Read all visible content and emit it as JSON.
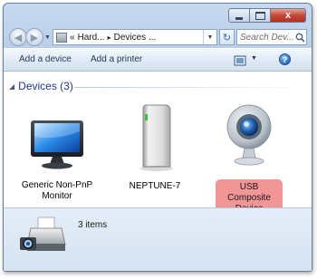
{
  "titlebar": {
    "minimize_glyph": "",
    "maximize_glyph": "",
    "close_glyph": "x"
  },
  "nav": {
    "address_crumbs": [
      "«",
      "Hard...",
      "Devices ..."
    ],
    "crumb_separator": "▸",
    "search_placeholder": "Search Dev...",
    "refresh_icon": "refresh-icon"
  },
  "toolbar": {
    "add_device": "Add a device",
    "add_printer": "Add a printer",
    "help_label": "?"
  },
  "group": {
    "title": "Devices (3)",
    "collapse_glyph": "◢"
  },
  "devices": [
    {
      "label": "Generic Non-PnP Monitor",
      "icon": "monitor-icon",
      "selected": false
    },
    {
      "label": "NEPTUNE-7",
      "icon": "external-drive-icon",
      "selected": false
    },
    {
      "label": "USB Composite Device",
      "icon": "webcam-icon",
      "selected": true
    }
  ],
  "details": {
    "count_text": "3 items",
    "icon": "devices-printers-icon"
  },
  "colors": {
    "selection": "#f19597",
    "group_title": "#1e3a8a",
    "toolbar_text": "#1e395b"
  }
}
